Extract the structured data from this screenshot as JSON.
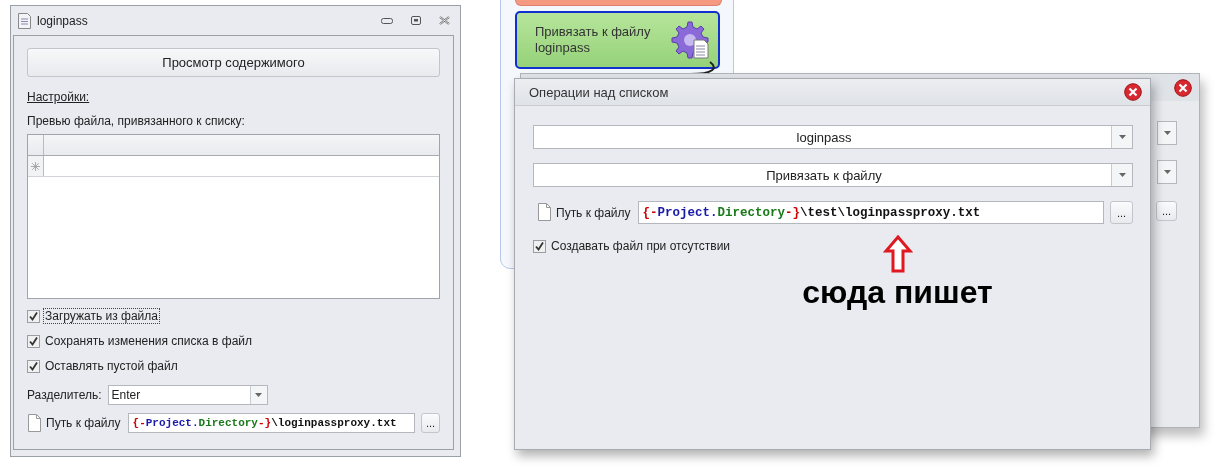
{
  "window": {
    "title": "loginpass"
  },
  "view_button": "Просмотр содержимого",
  "settings_link": "Настройки:",
  "preview_label": "Превью файла, привязанного к списку:",
  "checkboxes": [
    {
      "label": "Загружать из файла",
      "checked": true,
      "focused": true
    },
    {
      "label": "Сохранять изменения списка в файл",
      "checked": true,
      "focused": false
    },
    {
      "label": "Оставлять пустой файл",
      "checked": true,
      "focused": false
    }
  ],
  "separator": {
    "label": "Разделитель:",
    "value": "Enter"
  },
  "file_path": {
    "label": "Путь к файлу",
    "browse": "...",
    "segments": [
      {
        "text": "{-",
        "color": "#cc0000"
      },
      {
        "text": "Project.",
        "color": "#1a1aaa"
      },
      {
        "text": "Directory",
        "color": "#1a7a1a"
      },
      {
        "text": "-}",
        "color": "#cc0000"
      },
      {
        "text": "\\loginpassproxy.txt",
        "color": "#111111"
      }
    ]
  },
  "canvas": {
    "action_block": {
      "label": "Привязать к файлу\nloginpass",
      "selected": true
    }
  },
  "back_dialog": {
    "browse": "..."
  },
  "dialog": {
    "title": "Операции над списком",
    "list_combo": "loginpass",
    "action_combo": "Привязать к файлу",
    "file_path": {
      "label": "Путь к файлу",
      "browse": "...",
      "segments": [
        {
          "text": "{-",
          "color": "#cc0000"
        },
        {
          "text": "Project.",
          "color": "#1a1aaa"
        },
        {
          "text": "Directory",
          "color": "#1a7a1a"
        },
        {
          "text": "-}",
          "color": "#cc0000"
        },
        {
          "text": "\\test\\loginpassproxy.txt",
          "color": "#111111"
        }
      ]
    },
    "checkbox": {
      "label": "Создавать файл при отсутствии",
      "checked": true
    }
  },
  "annotation": {
    "text": "сюда пишет"
  }
}
